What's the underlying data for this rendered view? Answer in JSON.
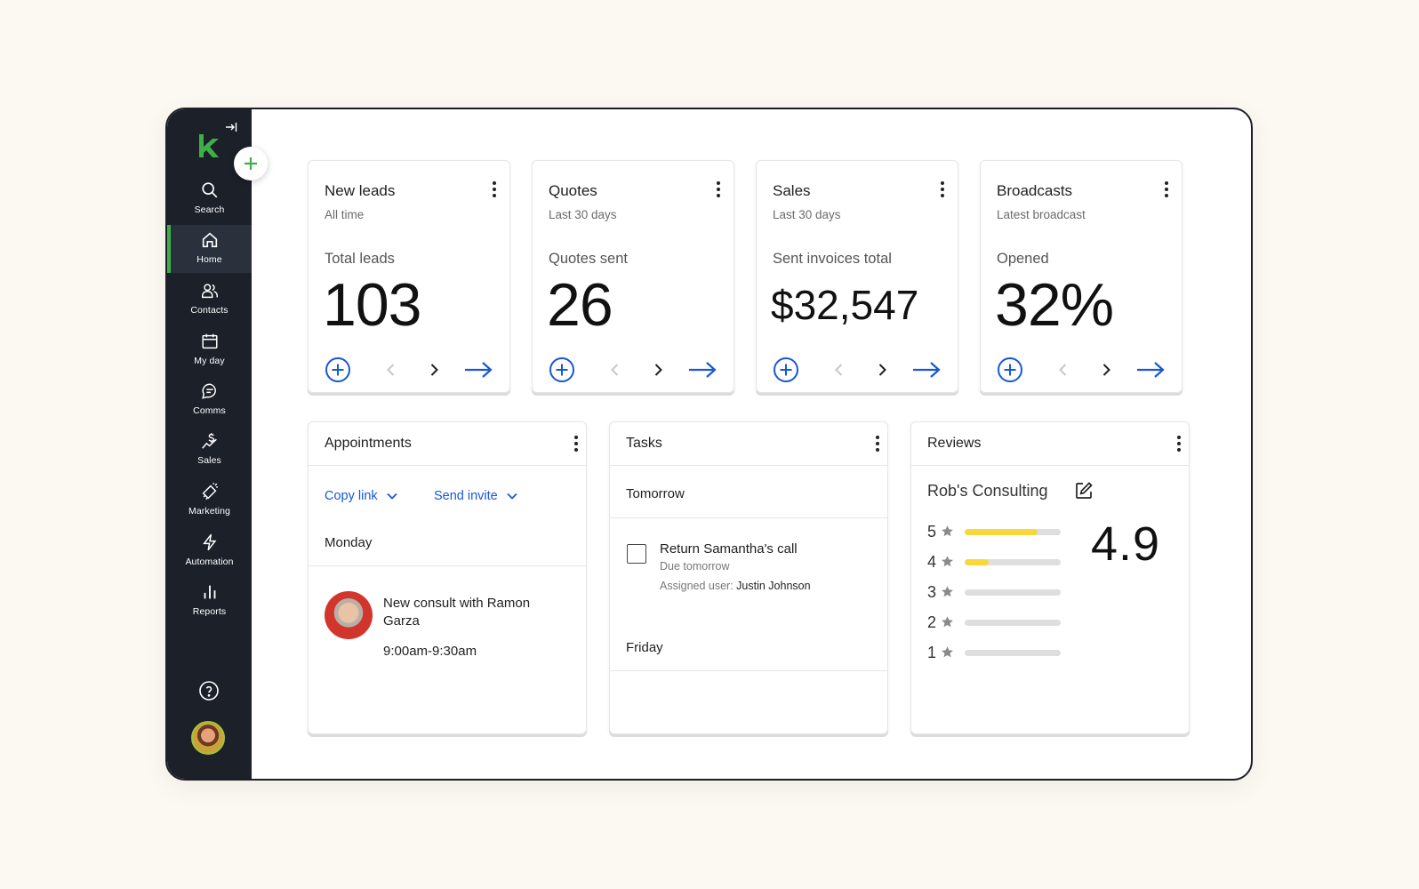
{
  "sidebar": {
    "items": [
      {
        "label": "Search",
        "icon": "search-icon"
      },
      {
        "label": "Home",
        "icon": "home-icon",
        "active": true
      },
      {
        "label": "Contacts",
        "icon": "contacts-icon"
      },
      {
        "label": "My day",
        "icon": "calendar-icon"
      },
      {
        "label": "Comms",
        "icon": "chat-icon"
      },
      {
        "label": "Sales",
        "icon": "sales-icon"
      },
      {
        "label": "Marketing",
        "icon": "megaphone-icon"
      },
      {
        "label": "Automation",
        "icon": "lightning-icon"
      },
      {
        "label": "Reports",
        "icon": "bar-chart-icon"
      }
    ]
  },
  "stats": [
    {
      "title": "New leads",
      "subtitle": "All time",
      "metric_label": "Total leads",
      "value": "103"
    },
    {
      "title": "Quotes",
      "subtitle": "Last 30 days",
      "metric_label": "Quotes sent",
      "value": "26"
    },
    {
      "title": "Sales",
      "subtitle": "Last 30 days",
      "metric_label": "Sent invoices total",
      "value": "$32,547"
    },
    {
      "title": "Broadcasts",
      "subtitle": "Latest broadcast",
      "metric_label": "Opened",
      "value": "32%"
    }
  ],
  "appointments": {
    "title": "Appointments",
    "copy_link": "Copy link",
    "send_invite": "Send invite",
    "day": "Monday",
    "item": {
      "title": "New consult with Ramon Garza",
      "time": "9:00am-9:30am"
    }
  },
  "tasks": {
    "title": "Tasks",
    "group1": "Tomorrow",
    "task": {
      "title": "Return Samantha's call",
      "due": "Due tomorrow",
      "assigned_label": "Assigned user:",
      "assigned_user": "Justin Johnson",
      "completed": false
    },
    "group2": "Friday"
  },
  "reviews": {
    "title": "Reviews",
    "business": "Rob's Consulting",
    "average": "4.9",
    "distribution": [
      {
        "stars": "5",
        "fraction": 0.76
      },
      {
        "stars": "4",
        "fraction": 0.25
      },
      {
        "stars": "3",
        "fraction": 0
      },
      {
        "stars": "2",
        "fraction": 0
      },
      {
        "stars": "1",
        "fraction": 0
      }
    ]
  },
  "colors": {
    "sidebar_bg": "#1b2029",
    "accent_green": "#3fae49",
    "link_blue": "#1857d6",
    "rating_yellow": "#f5d93c",
    "page_bg": "#fcf8f2"
  }
}
